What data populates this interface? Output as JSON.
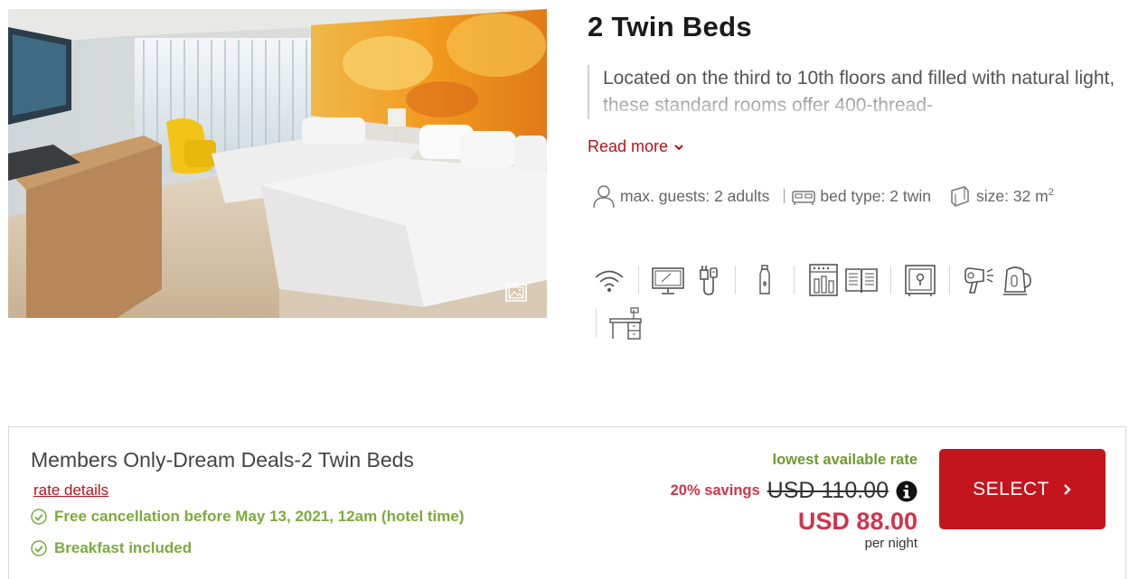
{
  "room": {
    "title": "2 Twin Beds",
    "description": "Located on the third to 10th floors and filled with natural light, these standard rooms offer 400-thread-",
    "read_more": "Read more",
    "specs": {
      "guests": "max. guests: 2 adults",
      "bed": "bed type: 2 twin",
      "size_value": "size: 32 m",
      "size_unit_sup": "2"
    },
    "amenity_icons": [
      "wifi-icon",
      "tv-icon",
      "charger-icon",
      "water-bottle-icon",
      "minibar-icon",
      "book-icon",
      "safe-icon",
      "hair-dryer-icon",
      "kettle-icon",
      "desk-icon"
    ],
    "photo_icons": [
      "gallery-icon"
    ]
  },
  "rate": {
    "name": "Members Only-Dream Deals-2 Twin Beds",
    "details_link": "rate details",
    "perks": [
      "Free cancellation before May 13, 2021, 12am (hotel time)",
      "Breakfast included"
    ],
    "lowest_label": "lowest available rate",
    "savings": "20% savings",
    "old_price": "USD 110.00",
    "price": "USD 88.00",
    "per_night": "per night",
    "select_label": "SELECT"
  },
  "colors": {
    "brand_red": "#c4151c",
    "price_red": "#d2334a",
    "perk_green": "#7cab3c",
    "lowest_green": "#6f9a2e"
  }
}
